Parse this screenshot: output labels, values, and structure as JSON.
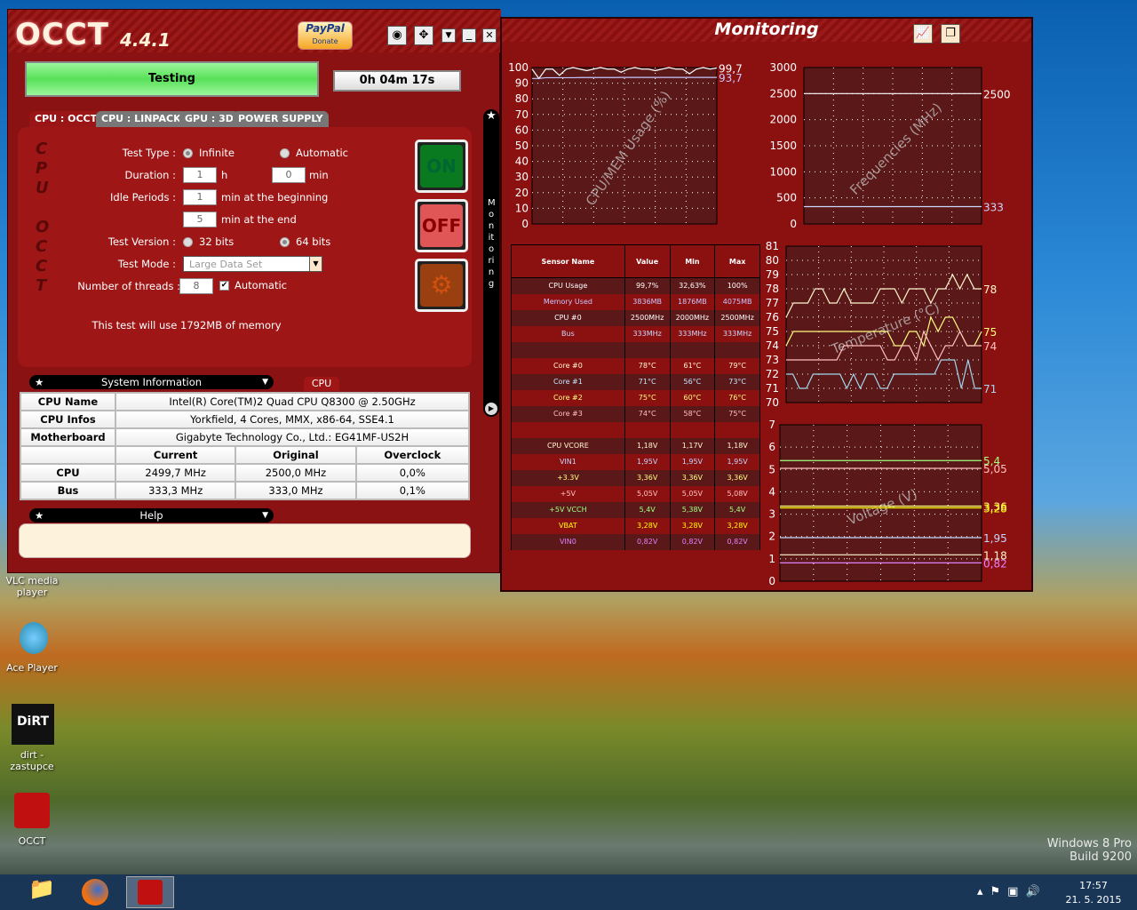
{
  "app": {
    "logo": "OCCT",
    "version": "4.4.1",
    "paypal": "PayPal",
    "donate": "Donate",
    "status": "Testing",
    "elapsed": "0h 04m 17s"
  },
  "tabs": [
    "CPU : OCCT",
    "CPU : LINPACK",
    "GPU : 3D",
    "POWER SUPPLY"
  ],
  "side_letters": [
    "C",
    "P",
    "U",
    "O",
    "C",
    "C",
    "T"
  ],
  "form": {
    "test_type_label": "Test Type :",
    "infinite": "Infinite",
    "automatic": "Automatic",
    "duration_label": "Duration :",
    "hours": "1",
    "h": "h",
    "minutes": "0",
    "min": "min",
    "idle_label": "Idle Periods :",
    "idle_begin": "1",
    "idle_begin_txt": "min at the beginning",
    "idle_end": "5",
    "idle_end_txt": "min at the end",
    "version_label": "Test Version :",
    "v32": "32 bits",
    "v64": "64 bits",
    "mode_label": "Test Mode :",
    "mode_value": "Large Data Set",
    "threads_label": "Number of threads :",
    "threads": "8",
    "threads_auto": "Automatic",
    "memory_note": "This test will use 1792MB of memory"
  },
  "buttons": {
    "on": "ON",
    "off": "OFF"
  },
  "sysinfo": {
    "title": "System Information",
    "tab": "CPU",
    "rows": [
      [
        "CPU Name",
        "Intel(R) Core(TM)2 Quad CPU Q8300 @ 2.50GHz"
      ],
      [
        "CPU Infos",
        "Yorkfield, 4 Cores, MMX, x86-64, SSE4.1"
      ],
      [
        "Motherboard",
        "Gigabyte Technology Co., Ltd.: EG41MF-US2H"
      ]
    ],
    "clock_headers": [
      "",
      "Current",
      "Original",
      "Overclock"
    ],
    "clock_rows": [
      [
        "CPU",
        "2499,7 MHz",
        "2500,0 MHz",
        "0,0%"
      ],
      [
        "Bus",
        "333,3 MHz",
        "333,0 MHz",
        "0,1%"
      ]
    ]
  },
  "help": {
    "title": "Help"
  },
  "monitoring": {
    "title": "Monitoring",
    "side_label": "Monitoring",
    "sensor_headers": [
      "Sensor Name",
      "Value",
      "Min",
      "Max"
    ],
    "sensors": [
      {
        "name": "CPU Usage",
        "value": "99,7%",
        "min": "32,63%",
        "max": "100%",
        "color": "#ffffff"
      },
      {
        "name": "Memory Used",
        "value": "3836MB",
        "min": "1876MB",
        "max": "4075MB",
        "color": "#c8c8ff"
      },
      {
        "name": "CPU #0",
        "value": "2500MHz",
        "min": "2000MHz",
        "max": "2500MHz",
        "color": "#ffffff"
      },
      {
        "name": "Bus",
        "value": "333MHz",
        "min": "333MHz",
        "max": "333MHz",
        "color": "#c8d8ff"
      },
      {
        "name": "",
        "value": "",
        "min": "",
        "max": "",
        "color": "#fff"
      },
      {
        "name": "Core #0",
        "value": "78°C",
        "min": "61°C",
        "max": "79°C",
        "color": "#fff8d0"
      },
      {
        "name": "Core #1",
        "value": "71°C",
        "min": "56°C",
        "max": "73°C",
        "color": "#c0e8ff"
      },
      {
        "name": "Core #2",
        "value": "75°C",
        "min": "60°C",
        "max": "76°C",
        "color": "#ffff80"
      },
      {
        "name": "Core #3",
        "value": "74°C",
        "min": "58°C",
        "max": "75°C",
        "color": "#ffc0c0"
      },
      {
        "name": "",
        "value": "",
        "min": "",
        "max": "",
        "color": "#fff"
      },
      {
        "name": "CPU VCORE",
        "value": "1,18V",
        "min": "1,17V",
        "max": "1,18V",
        "color": "#fff8d0"
      },
      {
        "name": "VIN1",
        "value": "1,95V",
        "min": "1,95V",
        "max": "1,95V",
        "color": "#c0d8ff"
      },
      {
        "name": "+3.3V",
        "value": "3,36V",
        "min": "3,36V",
        "max": "3,36V",
        "color": "#ffff80"
      },
      {
        "name": "+5V",
        "value": "5,05V",
        "min": "5,05V",
        "max": "5,08V",
        "color": "#ffc0c0"
      },
      {
        "name": "+5V VCCH",
        "value": "5,4V",
        "min": "5,38V",
        "max": "5,4V",
        "color": "#a0ff80"
      },
      {
        "name": "VBAT",
        "value": "3,28V",
        "min": "3,28V",
        "max": "3,28V",
        "color": "#ffff00"
      },
      {
        "name": "VIN0",
        "value": "0,82V",
        "min": "0,82V",
        "max": "0,82V",
        "color": "#e080ff"
      }
    ]
  },
  "chart_data": [
    {
      "type": "line",
      "title": "CPU/MEM Usage (%)",
      "ylim": [
        0,
        100
      ],
      "yticks": [
        0,
        10,
        20,
        30,
        40,
        50,
        60,
        70,
        80,
        90,
        100
      ],
      "series": [
        {
          "name": "CPU Usage",
          "color": "#ffffff",
          "end_label": "99,7",
          "values": [
            99,
            93,
            99,
            99,
            95,
            99,
            100,
            99,
            98,
            99,
            100,
            99,
            99,
            97,
            99,
            100,
            99,
            99,
            98,
            99,
            100,
            99,
            99,
            96,
            99,
            100,
            99,
            99.7
          ]
        },
        {
          "name": "Memory Used",
          "color": "#c8c8ff",
          "end_label": "93,7",
          "values": [
            93,
            93,
            93.5,
            93.5,
            93.5,
            93.5,
            93.5,
            93.6,
            93.6,
            93.6,
            93.6,
            93.6,
            93.6,
            93.7,
            93.7,
            93.7,
            93.7,
            93.7,
            93.7,
            93.7,
            93.7,
            93.7,
            93.7,
            93.7,
            93.7,
            93.7,
            93.7,
            93.7
          ]
        }
      ]
    },
    {
      "type": "line",
      "title": "Frequencies (MHz)",
      "ylim": [
        0,
        3000
      ],
      "yticks": [
        0,
        500,
        1000,
        1500,
        2000,
        2500,
        3000
      ],
      "series": [
        {
          "name": "CPU #0",
          "color": "#ffffff",
          "end_label": "2500",
          "values": [
            2500,
            2500
          ]
        },
        {
          "name": "Bus",
          "color": "#c8d8ff",
          "end_label": "333",
          "values": [
            333,
            333
          ]
        }
      ]
    },
    {
      "type": "line",
      "title": "Temperature (°C)",
      "ylim": [
        70,
        81
      ],
      "yticks": [
        70,
        71,
        72,
        73,
        74,
        75,
        76,
        77,
        78,
        79,
        80,
        81
      ],
      "series": [
        {
          "name": "Core #0",
          "color": "#fff8d0",
          "end_label": "78",
          "values": [
            76,
            77,
            77,
            77,
            78,
            78,
            77,
            77,
            78,
            77,
            77,
            77,
            77,
            78,
            78,
            78,
            77,
            78,
            78,
            78,
            77,
            78,
            78,
            79,
            78,
            79,
            78,
            78
          ]
        },
        {
          "name": "Core #2",
          "color": "#ffff80",
          "end_label": "75",
          "values": [
            74,
            75,
            75,
            75,
            75,
            75,
            75,
            75,
            75,
            75,
            75,
            75,
            75,
            75,
            75,
            74,
            74,
            75,
            75,
            74,
            76,
            75,
            76,
            76,
            75,
            74,
            74,
            75
          ]
        },
        {
          "name": "Core #3",
          "color": "#ffc0c0",
          "end_label": "74",
          "values": [
            73,
            73,
            73,
            73,
            73,
            73,
            73,
            73,
            74,
            74,
            74,
            74,
            74,
            74,
            73,
            73,
            74,
            74,
            73,
            75,
            74,
            73,
            74,
            74,
            75,
            74,
            74,
            74
          ]
        },
        {
          "name": "Core #1",
          "color": "#a0d8f0",
          "end_label": "71",
          "values": [
            72,
            72,
            71,
            71,
            72,
            72,
            72,
            72,
            72,
            71,
            72,
            71,
            72,
            72,
            71,
            71,
            72,
            72,
            72,
            72,
            72,
            72,
            72,
            73,
            73,
            73,
            71,
            73,
            71,
            71
          ]
        }
      ]
    },
    {
      "type": "line",
      "title": "Voltage (V)",
      "ylim": [
        0,
        7
      ],
      "yticks": [
        0,
        1,
        2,
        3,
        4,
        5,
        6,
        7
      ],
      "series": [
        {
          "name": "+5V VCCH",
          "color": "#a0ff80",
          "end_label": "5,4",
          "values": [
            5.4,
            5.4
          ]
        },
        {
          "name": "+5V",
          "color": "#ffc0c0",
          "end_label": "5,05",
          "values": [
            5.05,
            5.05
          ]
        },
        {
          "name": "+3.3V",
          "color": "#ffff80",
          "end_label": "3,36",
          "values": [
            3.36,
            3.36
          ]
        },
        {
          "name": "VBAT",
          "color": "#ffff00",
          "end_label": "3,28",
          "values": [
            3.28,
            3.28
          ]
        },
        {
          "name": "VIN1",
          "color": "#c0d8ff",
          "end_label": "1,95",
          "values": [
            1.95,
            1.95
          ]
        },
        {
          "name": "CPU VCORE",
          "color": "#fff8d0",
          "end_label": "1,18",
          "values": [
            1.18,
            1.18
          ]
        },
        {
          "name": "VIN0",
          "color": "#e080ff",
          "end_label": "0,82",
          "values": [
            0.82,
            0.82
          ]
        }
      ]
    }
  ],
  "desktop": {
    "icons": [
      "VLC media player",
      "Ace Player",
      "dirt - zastupce",
      "OCCT"
    ],
    "watermark1": "Windows 8 Pro",
    "watermark2": "Build 9200"
  },
  "taskbar": {
    "time": "17:57",
    "date": "21. 5. 2015"
  }
}
